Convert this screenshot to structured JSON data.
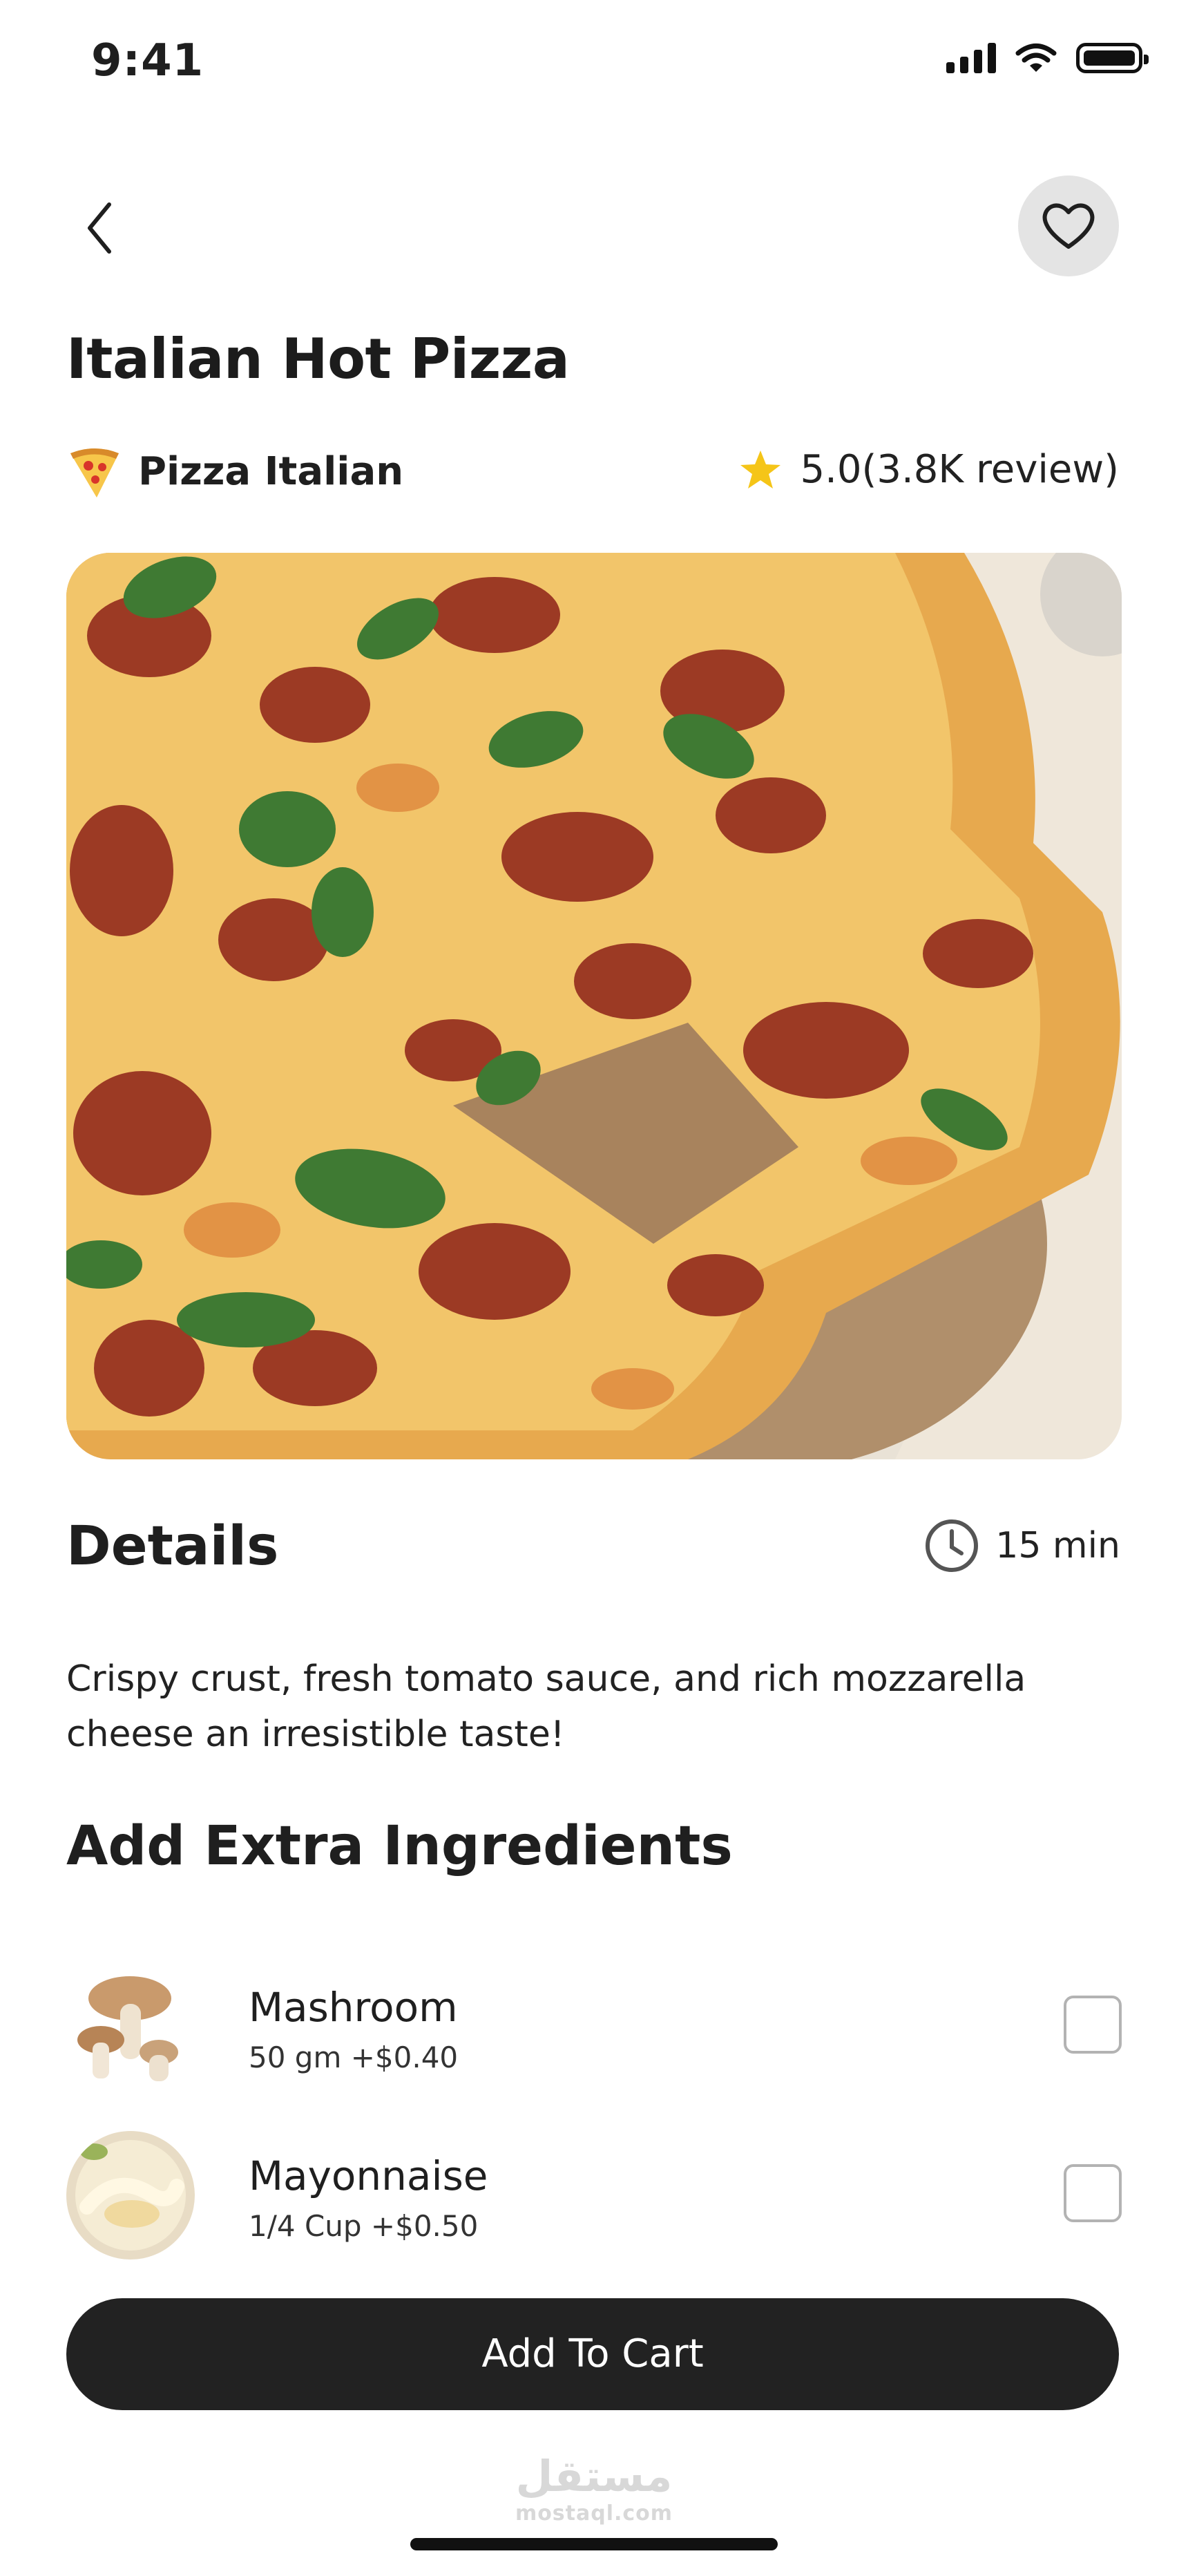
{
  "status_bar": {
    "time": "9:41",
    "icons": [
      "signal-icon",
      "wifi-icon",
      "battery-icon"
    ]
  },
  "header": {
    "back_icon": "chevron-left-icon",
    "favorite_icon": "heart-icon"
  },
  "product": {
    "title": "Italian Hot Pizza",
    "category_icon": "pizza-slice-icon",
    "category": "Pizza Italian",
    "rating_icon": "star-icon",
    "rating": "5.0(3.8K review)",
    "image_subject": "pizza-photo"
  },
  "details": {
    "heading": "Details",
    "time_icon": "clock-icon",
    "time": "15 min",
    "description": "Crispy crust, fresh tomato sauce, and rich mozzarella cheese an irresistible taste!"
  },
  "extras": {
    "heading": "Add Extra Ingredients",
    "items": [
      {
        "name": "Mashroom",
        "detail": "50 gm +$0.40",
        "checked": false,
        "thumb": "mushroom-photo"
      },
      {
        "name": "Mayonnaise",
        "detail": "1/4 Cup +$0.50",
        "checked": false,
        "thumb": "mayonnaise-photo"
      }
    ]
  },
  "cart_button": {
    "label": "Add To Cart"
  },
  "watermark": {
    "arabic": "مستقل",
    "latin": "mostaql.com"
  },
  "colors": {
    "accent_dark": "#222222",
    "star": "#f5c518",
    "favorite_bg": "#e4e4e4"
  }
}
